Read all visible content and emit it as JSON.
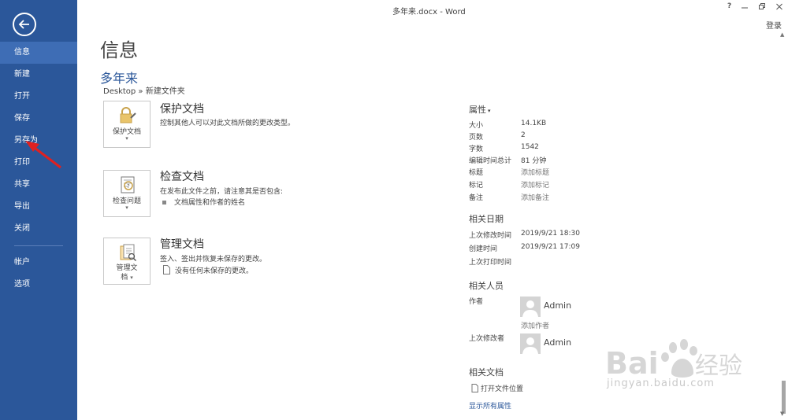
{
  "window": {
    "title": "多年来.docx - Word",
    "help": "?",
    "login": "登录"
  },
  "sidebar": {
    "items": [
      {
        "label": "信息"
      },
      {
        "label": "新建"
      },
      {
        "label": "打开"
      },
      {
        "label": "保存"
      },
      {
        "label": "另存为"
      },
      {
        "label": "打印"
      },
      {
        "label": "共享"
      },
      {
        "label": "导出"
      },
      {
        "label": "关闭"
      },
      {
        "label": "帐户"
      },
      {
        "label": "选项"
      }
    ],
    "active_index": 0
  },
  "main": {
    "page_title": "信息",
    "doc_name": "多年来",
    "doc_path": "Desktop » 新建文件夹",
    "sections": [
      {
        "button_label": "保护文档",
        "title": "保护文档",
        "desc": "控制其他人可以对此文档所做的更改类型。",
        "bullet": ""
      },
      {
        "button_label": "检查问题",
        "title": "检查文档",
        "desc": "在发布此文件之前，请注意其是否包含:",
        "bullet": "文档属性和作者的姓名"
      },
      {
        "button_label_1": "管理文",
        "button_label_2": "档",
        "title": "管理文档",
        "desc": "签入、签出并恢复未保存的更改。",
        "bullet": "没有任何未保存的更改。"
      }
    ]
  },
  "properties": {
    "header": "属性",
    "rows": [
      {
        "label": "大小",
        "value": "14.1KB"
      },
      {
        "label": "页数",
        "value": "2"
      },
      {
        "label": "字数",
        "value": "1542"
      },
      {
        "label": "编辑时间总计",
        "value": "81 分钟"
      },
      {
        "label": "标题",
        "value": "添加标题"
      },
      {
        "label": "标记",
        "value": "添加标记"
      },
      {
        "label": "备注",
        "value": "添加备注"
      }
    ],
    "dates_header": "相关日期",
    "dates": [
      {
        "label": "上次修改时间",
        "value": "2019/9/21 18:30"
      },
      {
        "label": "创建时间",
        "value": "2019/9/21 17:09"
      },
      {
        "label": "上次打印时间",
        "value": ""
      }
    ],
    "people_header": "相关人员",
    "author_label": "作者",
    "author_name": "Admin",
    "add_author": "添加作者",
    "modifier_label": "上次修改者",
    "modifier_name": "Admin",
    "docs_header": "相关文档",
    "open_location": "打开文件位置",
    "show_all": "显示所有属性"
  },
  "watermark": {
    "text": "jingyan.baidu.com"
  },
  "colors": {
    "sidebar_bg": "#2b579a",
    "sidebar_active": "#3e6db5",
    "accent_text": "#2b579a",
    "annotation_arrow": "#e02020"
  }
}
